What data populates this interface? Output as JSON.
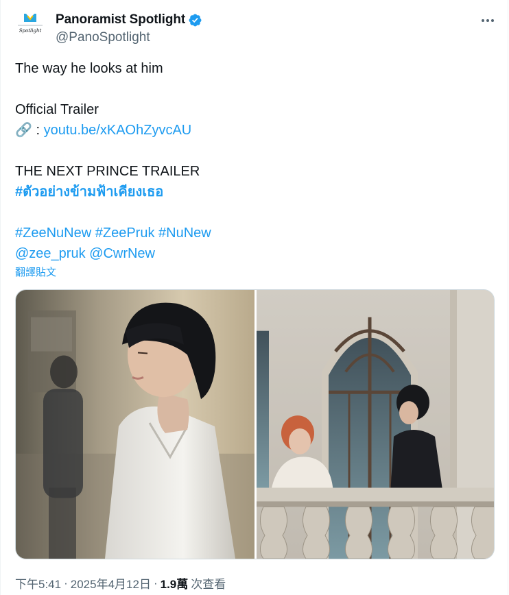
{
  "author": {
    "name": "Panoramist Spotlight",
    "handle": "@PanoSpotlight",
    "verified": true,
    "avatar_text": "Spotlight",
    "avatar_small_text": "PANORAMIST"
  },
  "tweet": {
    "line1": "The way he looks at him",
    "line2": "Official Trailer",
    "link_prefix": " : ",
    "link_icon": "🔗",
    "link_text": "youtu.be/xKAOhZyvcAU",
    "line3": "THE NEXT PRINCE TRAILER",
    "hashtag_thai": "#ตัวอย่างข้ามฟ้าเคียงเธอ",
    "hashtags": [
      "#ZeeNuNew",
      "#ZeePruk",
      "#NuNew"
    ],
    "mentions": [
      "@zee_pruk",
      "@CwrNew"
    ],
    "translate_label": "翻譯貼文"
  },
  "media": {
    "images": [
      {
        "name": "photo-left",
        "alt": "man in white shirt, eyes closed, sunlit stone wall"
      },
      {
        "name": "photo-right",
        "alt": "two young men on a stone balcony by a gothic window"
      }
    ]
  },
  "footer": {
    "time": "下午5:41",
    "separator": "·",
    "date": "2025年4月12日",
    "views_count": "1.9萬",
    "views_label": "次查看"
  },
  "colors": {
    "link": "#1d9bf0",
    "verified": "#1d9bf0",
    "secondary_text": "#536471",
    "primary_text": "#0f1419"
  }
}
